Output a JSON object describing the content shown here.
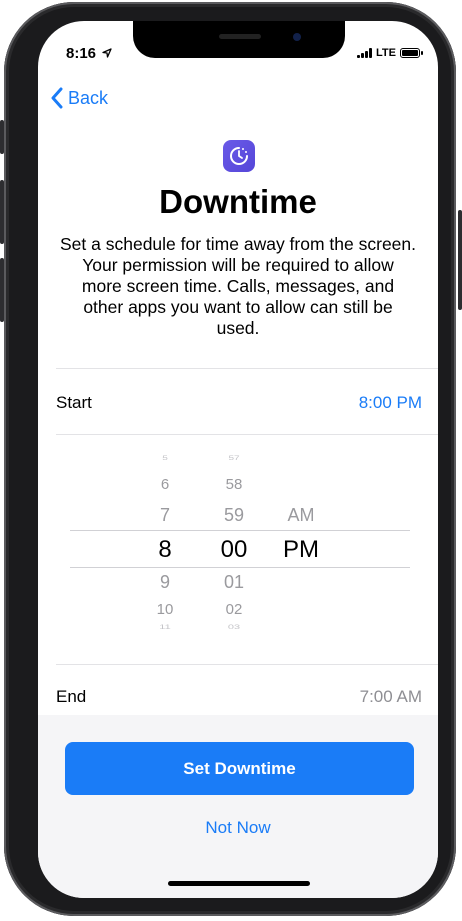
{
  "status_bar": {
    "time": "8:16",
    "network": "LTE"
  },
  "nav": {
    "back_label": "Back"
  },
  "header": {
    "title": "Downtime",
    "description": "Set a schedule for time away from the screen. Your permission will be required to allow more screen time. Calls, messages, and other apps you want to allow can still be used."
  },
  "start": {
    "label": "Start",
    "value": "8:00 PM"
  },
  "end": {
    "label": "End",
    "value": "7:00 AM"
  },
  "picker": {
    "hours": [
      "5",
      "6",
      "7",
      "8",
      "9",
      "10",
      "11"
    ],
    "minutes": [
      "57",
      "58",
      "59",
      "00",
      "01",
      "02",
      "03"
    ],
    "periods": [
      "AM",
      "PM"
    ],
    "selected": {
      "hour": "8",
      "minute": "00",
      "period": "PM"
    }
  },
  "actions": {
    "primary_label": "Set Downtime",
    "secondary_label": "Not Now"
  },
  "colors": {
    "accent": "#1a7cf7",
    "icon_purple": "#5b4ce0",
    "secondary_text": "#8e8e93"
  }
}
